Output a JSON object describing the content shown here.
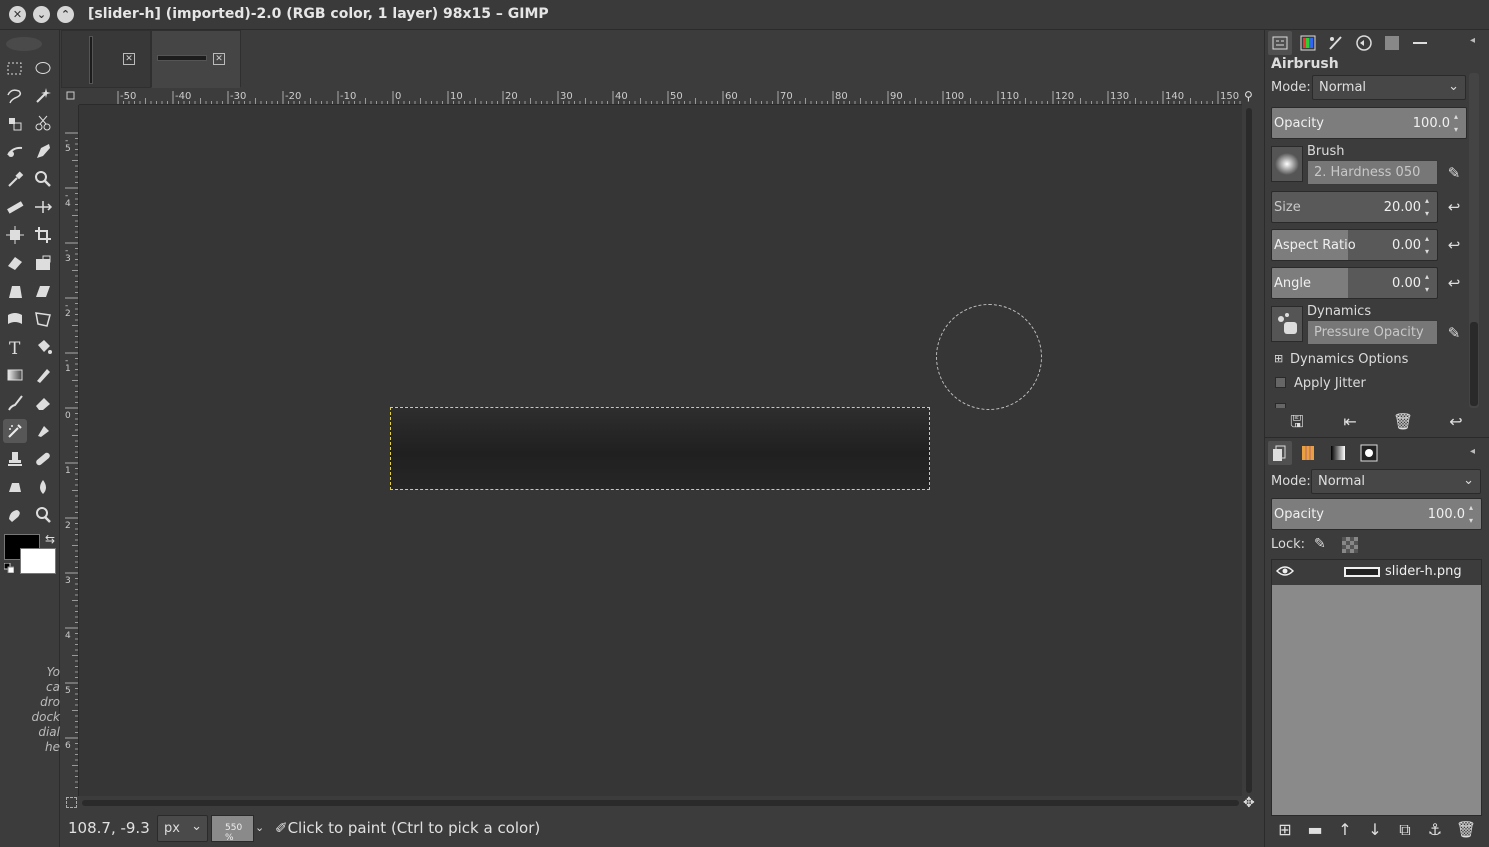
{
  "window": {
    "title": "[slider-h] (imported)-2.0 (RGB color, 1 layer) 98x15 – GIMP",
    "close_glyph": "✕",
    "minimize_glyph": "⌄",
    "maximize_glyph": "⌃"
  },
  "toolbox": {
    "hint_lines": [
      "Yo",
      "ca",
      "dro",
      "dock",
      "dial",
      "he"
    ],
    "foreground_color": "#000000",
    "background_color": "#ffffff"
  },
  "ruler": {
    "horizontal_ticks": [
      "-50",
      "-40",
      "-30",
      "-20",
      "-10",
      "0",
      "10",
      "20",
      "30",
      "40",
      "50",
      "60",
      "70",
      "80",
      "90",
      "100",
      "110",
      "120",
      "130",
      "140",
      "150"
    ],
    "vertical_ticks": [
      "-5",
      "-4",
      "-3",
      "-2",
      "-1",
      "0",
      "1",
      "2",
      "3",
      "4",
      "5",
      "6"
    ]
  },
  "statusbar": {
    "coords": "108.7, -9.3",
    "unit": "px",
    "zoom": "550 %",
    "message": "Click to paint (Ctrl to pick a color)"
  },
  "tool_options": {
    "title": "Airbrush",
    "mode_label": "Mode:",
    "mode_value": "Normal",
    "opacity_label": "Opacity",
    "opacity_value": "100.0",
    "opacity_fraction": 1.0,
    "brush_label": "Brush",
    "brush_value": "2. Hardness 050",
    "size_label": "Size",
    "size_value": "20.00",
    "aspect_label": "Aspect Ratio",
    "aspect_value": "0.00",
    "angle_label": "Angle",
    "angle_value": "0.00",
    "dynamics_label": "Dynamics",
    "dynamics_value": "Pressure Opacity",
    "dynamics_options_label": "Dynamics Options",
    "apply_jitter_label": "Apply Jitter"
  },
  "layers": {
    "mode_label": "Mode:",
    "mode_value": "Normal",
    "opacity_label": "Opacity",
    "opacity_value": "100.0",
    "lock_label": "Lock:",
    "items": [
      {
        "name": "slider-h.png",
        "visible": true
      }
    ]
  },
  "colors": {
    "selection_marching_ants": "#e6d23b",
    "canvas_bg": "#363636"
  }
}
